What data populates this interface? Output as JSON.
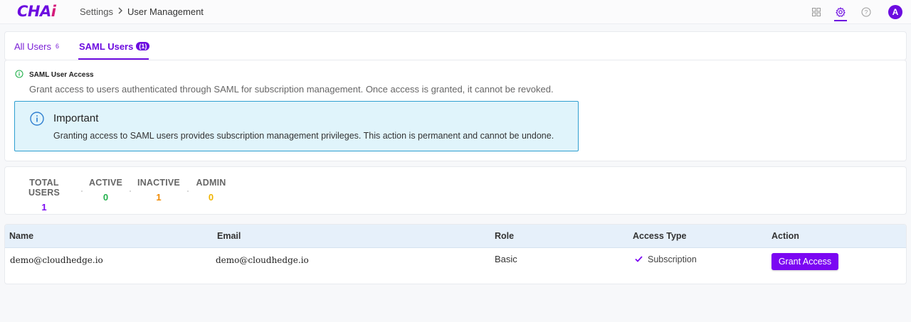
{
  "header": {
    "logo_main": "CHA",
    "logo_accent": "i",
    "breadcrumb": [
      "Settings",
      "User Management"
    ],
    "icons": [
      "apps-grid-icon",
      "gear-icon",
      "help-icon"
    ],
    "avatar_initial": "A"
  },
  "tabs": {
    "all_users": {
      "label": "All Users",
      "count": "6"
    },
    "saml_users": {
      "label": "SAML Users",
      "count": "(1)"
    }
  },
  "saml_info": {
    "title": "SAML User Access",
    "description": "Grant access to users authenticated through SAML for subscription management. Once access is granted, it cannot be revoked.",
    "important_title": "Important",
    "important_body": "Granting access to SAML users provides subscription management privileges. This action is permanent and cannot be undone."
  },
  "stats": [
    {
      "label": "TOTAL USERS",
      "value": "1",
      "color": "#7b07f2"
    },
    {
      "label": "ACTIVE",
      "value": "0",
      "color": "#22b14c"
    },
    {
      "label": "INACTIVE",
      "value": "1",
      "color": "#f08a00"
    },
    {
      "label": "ADMIN",
      "value": "0",
      "color": "#f0b400"
    }
  ],
  "table": {
    "columns": [
      "Name",
      "Email",
      "Role",
      "Access Type",
      "Action"
    ],
    "rows": [
      {
        "name": "demo@cloudhedge.io",
        "email": "demo@cloudhedge.io",
        "role": "Basic",
        "access_type": "Subscription",
        "action": "Grant Access"
      }
    ]
  },
  "colors": {
    "accent": "#6c0be0",
    "info_bg": "#e0f4fb",
    "info_border": "#2f9fd0",
    "success": "#22b14c"
  }
}
